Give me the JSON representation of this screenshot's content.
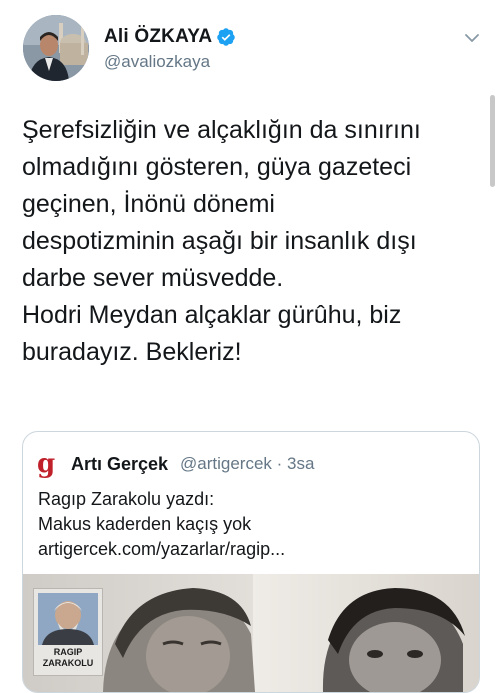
{
  "author": {
    "name": "Ali ÖZKAYA",
    "handle": "@avaliozkaya",
    "verified": true,
    "verified_color": "#1da1f2"
  },
  "tweet": {
    "lines": [
      "Şerefsizliğin ve alçaklığın da sınırını",
      "olmadığını gösteren, güya gazeteci",
      "geçinen, İnönü dönemi",
      "despotizminin aşağı bir insanlık dışı",
      "darbe sever müsvedde.",
      "Hodri Meydan alçaklar gürûhu, biz",
      "buradayız. Bekleriz!"
    ]
  },
  "quote": {
    "logo_glyph": "g",
    "logo_color": "#c0202a",
    "name": "Artı Gerçek",
    "handle_time": "@artigercek · 3sa",
    "lines": [
      "Ragıp Zarakolu yazdı:",
      "Makus kaderden kaçış yok",
      "artigercek.com/yazarlar/ragip..."
    ],
    "image": {
      "columnist_name_lines": [
        "RAGIP",
        "ZARAKOLU"
      ]
    }
  },
  "icons": {
    "more": "chevron-down-icon",
    "verified": "verified-badge-icon"
  }
}
